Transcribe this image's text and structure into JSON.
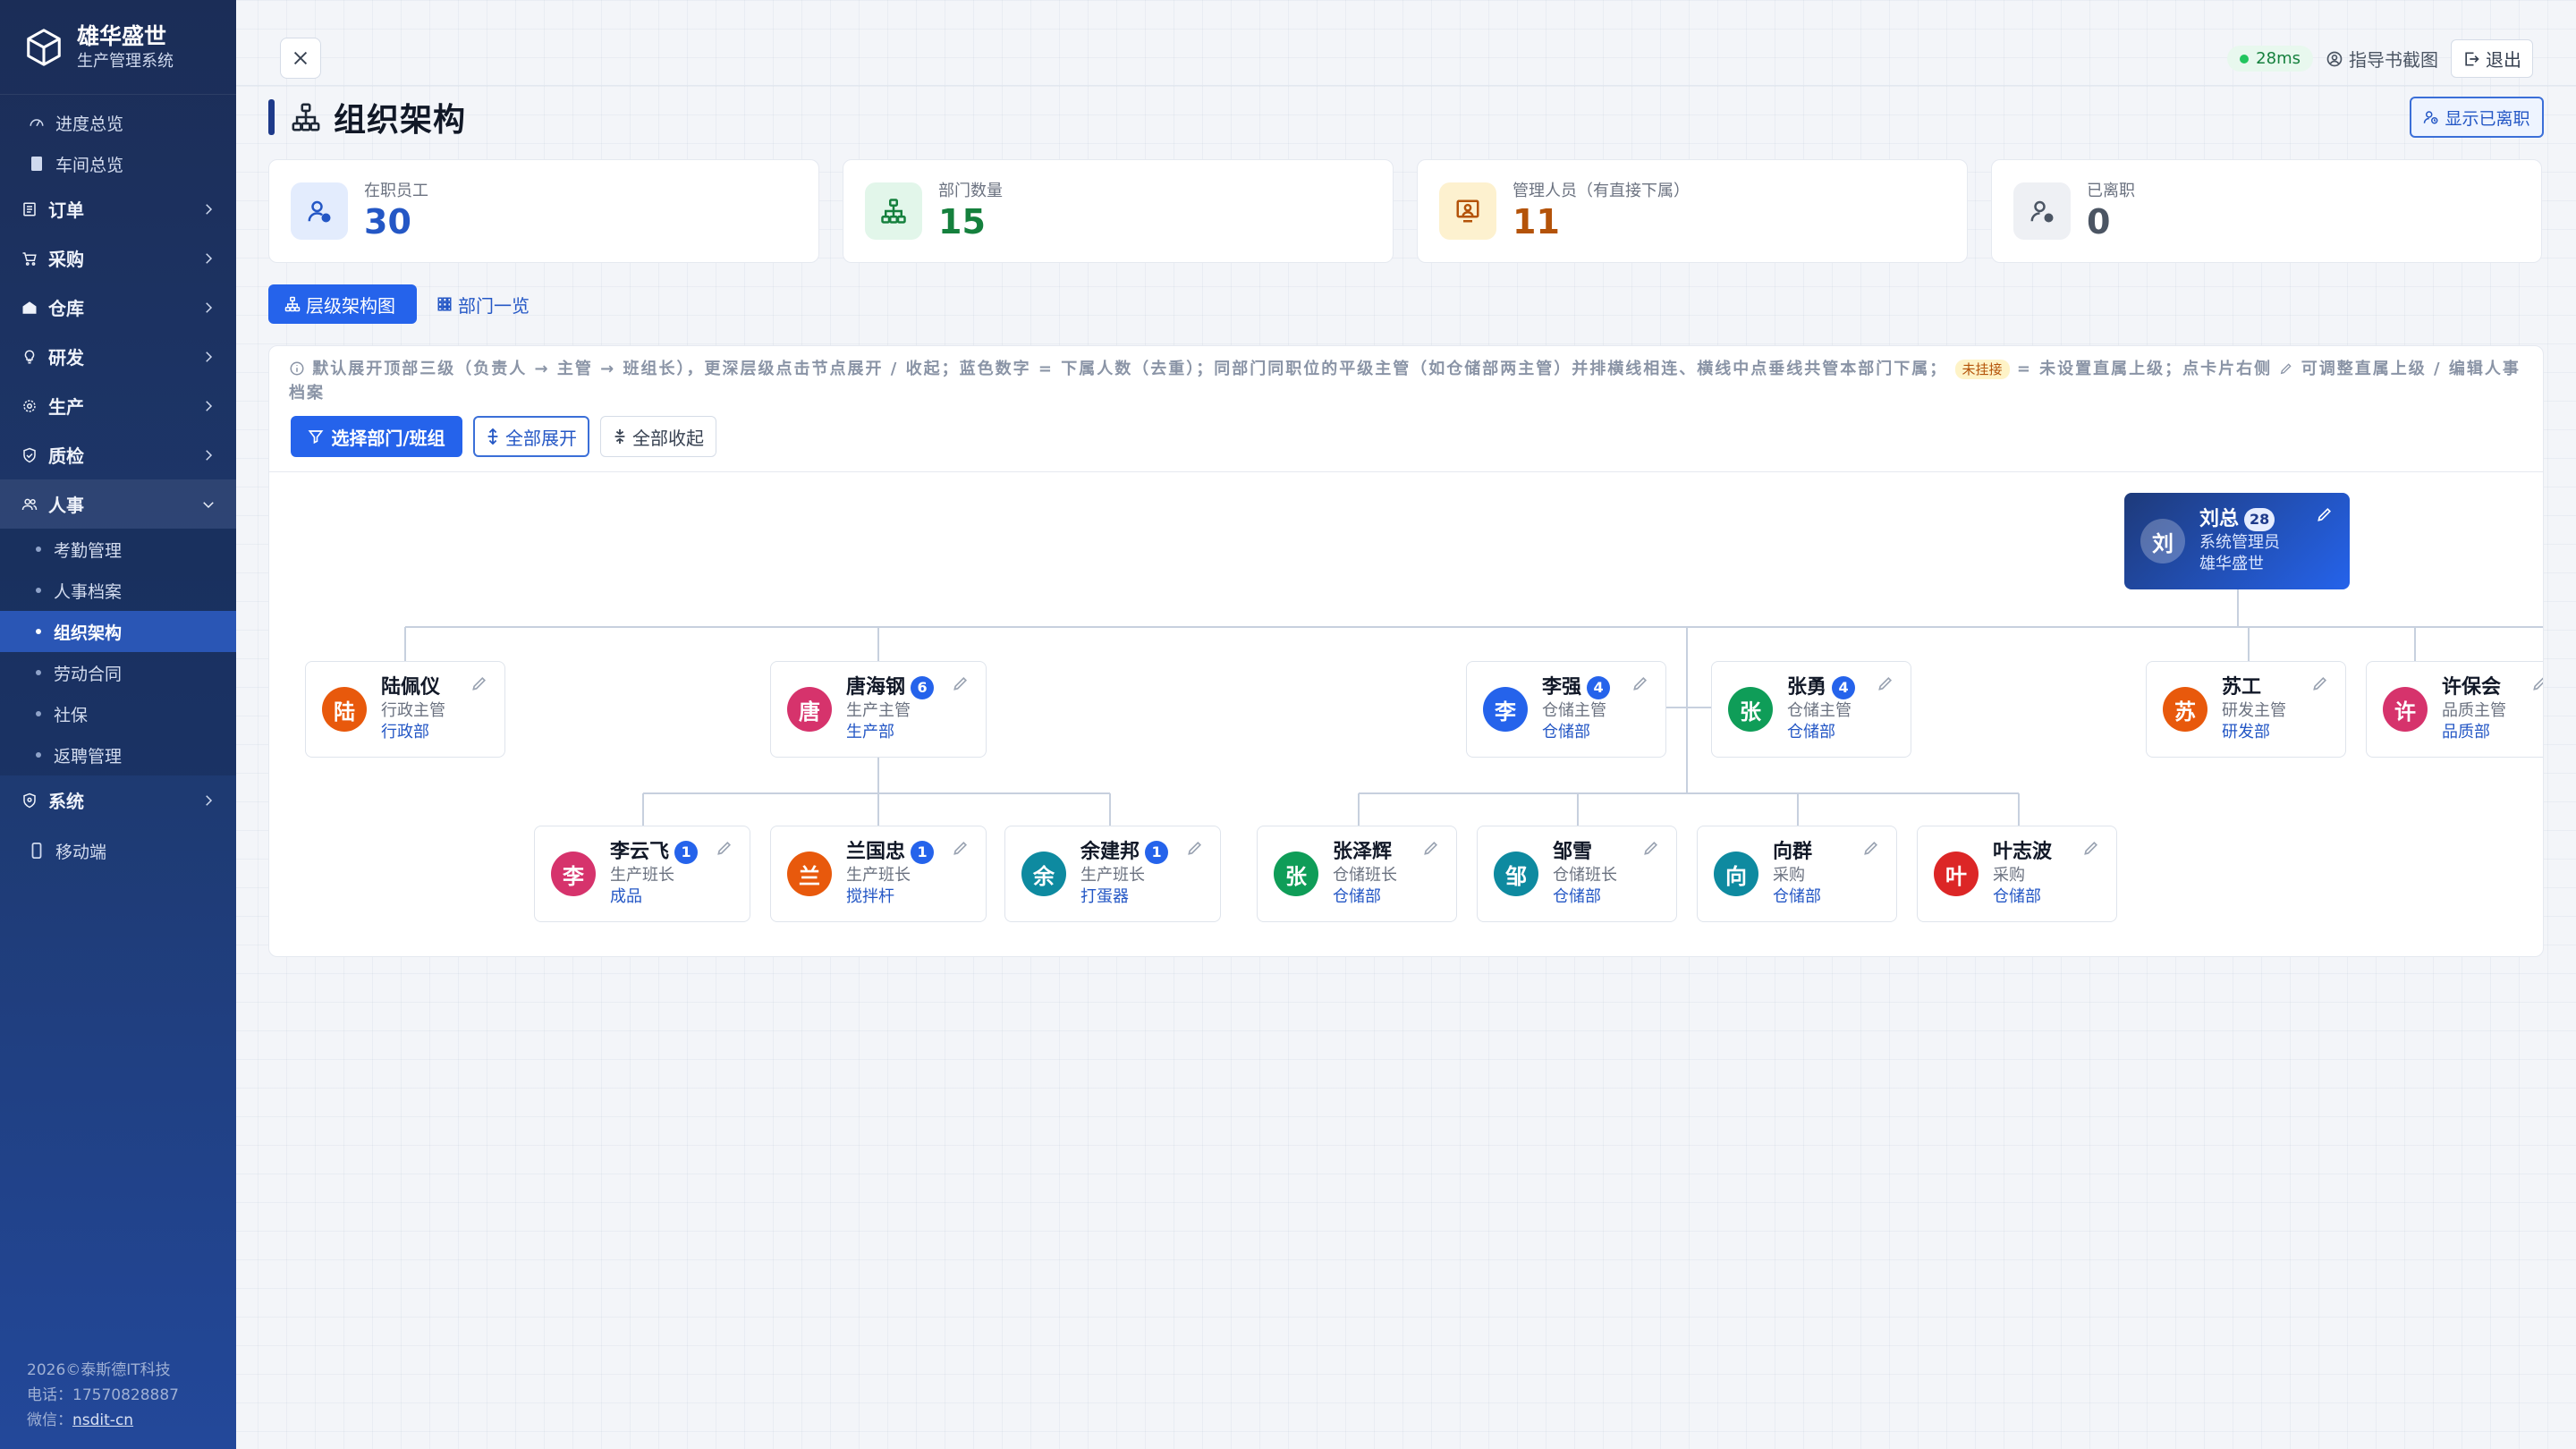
{
  "brand": {
    "title": "雄华盛世",
    "subtitle": "生产管理系统"
  },
  "sidebar": {
    "items": [
      {
        "label": "进度总览"
      },
      {
        "label": "车间总览"
      },
      {
        "label": "订单"
      },
      {
        "label": "采购"
      },
      {
        "label": "仓库"
      },
      {
        "label": "研发"
      },
      {
        "label": "生产"
      },
      {
        "label": "质检"
      },
      {
        "label": "人事"
      },
      {
        "label": "系统"
      },
      {
        "label": "移动端"
      }
    ],
    "hr_sub": [
      {
        "label": "考勤管理"
      },
      {
        "label": "人事档案"
      },
      {
        "label": "组织架构"
      },
      {
        "label": "劳动合同"
      },
      {
        "label": "社保"
      },
      {
        "label": "返聘管理"
      }
    ],
    "footer": {
      "copyright": "2026©泰斯德IT科技",
      "phone": "电话：17570828887",
      "wechat_label": "微信：",
      "wechat": "nsdit-cn"
    }
  },
  "topbar": {
    "latency": "28ms",
    "guide": "指导书截图",
    "logout": "退出"
  },
  "page": {
    "title": "组织架构",
    "show_resigned": "显示已离职"
  },
  "stats": [
    {
      "label": "在职员工",
      "value": "30",
      "color": "#2457c5"
    },
    {
      "label": "部门数量",
      "value": "15",
      "color": "#15803d"
    },
    {
      "label": "管理人员（有直接下属）",
      "value": "11",
      "color": "#b45309"
    },
    {
      "label": "已离职",
      "value": "0",
      "color": "#4b5563"
    }
  ],
  "tabs": {
    "hierarchy": "层级架构图",
    "departments": "部门一览"
  },
  "hint": {
    "text1": "默认展开顶部三级（负责人 → 主管 → 班组长），更深层级点击节点展开 / 收起；蓝色数字 = 下属人数（去重）；同部门同职位的平级主管（如仓储部两主管）并排横线相连、横线中点垂线共管本部门下属；",
    "tag": "未挂接",
    "text2": "= 未设置直属上级；点卡片右侧",
    "text3": "可调整直属上级 / 编辑人事档案"
  },
  "buttons": {
    "select": "选择部门/班组",
    "expand_all": "全部展开",
    "collapse_all": "全部收起"
  },
  "org": {
    "root": {
      "initial": "刘",
      "name": "刘总",
      "count": "28",
      "role": "系统管理员",
      "dept": "雄华盛世"
    },
    "level1": [
      {
        "initial": "陆",
        "name": "陆佩仪",
        "count": "",
        "role": "行政主管",
        "dept": "行政部",
        "color": "#e8590c"
      },
      {
        "initial": "唐",
        "name": "唐海钢",
        "count": "6",
        "role": "生产主管",
        "dept": "生产部",
        "color": "#d6336c"
      },
      {
        "initial": "李",
        "name": "李强",
        "count": "4",
        "role": "仓储主管",
        "dept": "仓储部",
        "color": "#2563eb"
      },
      {
        "initial": "张",
        "name": "张勇",
        "count": "4",
        "role": "仓储主管",
        "dept": "仓储部",
        "color": "#0f9d58"
      },
      {
        "initial": "苏",
        "name": "苏工",
        "count": "",
        "role": "研发主管",
        "dept": "研发部",
        "color": "#e8590c"
      },
      {
        "initial": "许",
        "name": "许保会",
        "count": "",
        "role": "品质主管",
        "dept": "品质部",
        "color": "#d6336c"
      }
    ],
    "level2": [
      {
        "initial": "李",
        "name": "李云飞",
        "count": "1",
        "role": "生产班长",
        "dept": "成品",
        "color": "#d6336c"
      },
      {
        "initial": "兰",
        "name": "兰国忠",
        "count": "1",
        "role": "生产班长",
        "dept": "搅拌杆",
        "color": "#e8590c"
      },
      {
        "initial": "余",
        "name": "余建邦",
        "count": "1",
        "role": "生产班长",
        "dept": "打蛋器",
        "color": "#0e8aa0"
      },
      {
        "initial": "张",
        "name": "张泽辉",
        "count": "",
        "role": "仓储班长",
        "dept": "仓储部",
        "color": "#0f9d58"
      },
      {
        "initial": "邹",
        "name": "邹雪",
        "count": "",
        "role": "仓储班长",
        "dept": "仓储部",
        "color": "#0e8aa0"
      },
      {
        "initial": "向",
        "name": "向群",
        "count": "",
        "role": "采购",
        "dept": "仓储部",
        "color": "#0e8aa0"
      },
      {
        "initial": "叶",
        "name": "叶志波",
        "count": "",
        "role": "采购",
        "dept": "仓储部",
        "color": "#dc2626"
      }
    ]
  }
}
